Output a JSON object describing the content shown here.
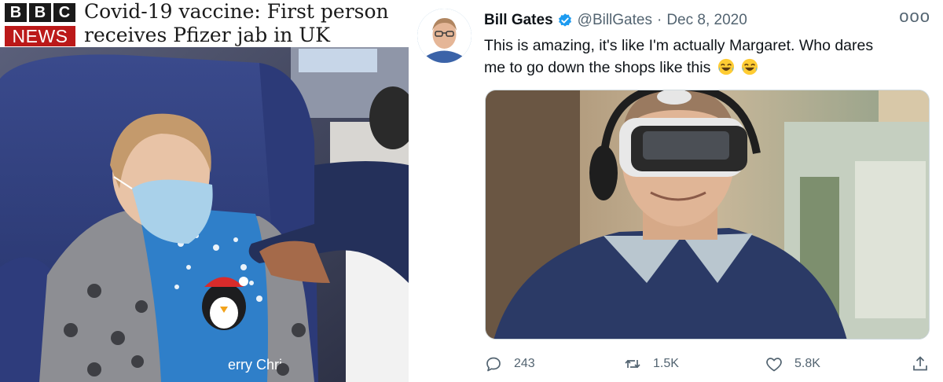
{
  "bbc": {
    "logo_letters": [
      "B",
      "B",
      "C"
    ],
    "logo_news": "NEWS",
    "headline_line1": "Covid-19 vaccine: First person",
    "headline_line2": "receives Pfizer jab in UK",
    "photo_caption_text": "erry Chri"
  },
  "tweet": {
    "display_name": "Bill Gates",
    "handle": "@BillGates",
    "separator": "·",
    "date": "Dec 8, 2020",
    "more_icon": "ooo",
    "text_line1": "This is amazing, it's like I'm actually Margaret. Who dares",
    "text_line2": "me to go down the shops like this",
    "emoji_count": 2,
    "actions": {
      "reply_count": "243",
      "retweet_count": "1.5K",
      "like_count": "5.8K"
    }
  },
  "colors": {
    "bbc_red": "#bb1919",
    "twitter_blue": "#1d9bf0",
    "text_primary": "#0f1419",
    "text_secondary": "#536471"
  },
  "icons": [
    "verified-badge-icon",
    "more-icon",
    "reply-icon",
    "retweet-icon",
    "like-icon",
    "share-icon",
    "laughing-emoji-icon"
  ]
}
